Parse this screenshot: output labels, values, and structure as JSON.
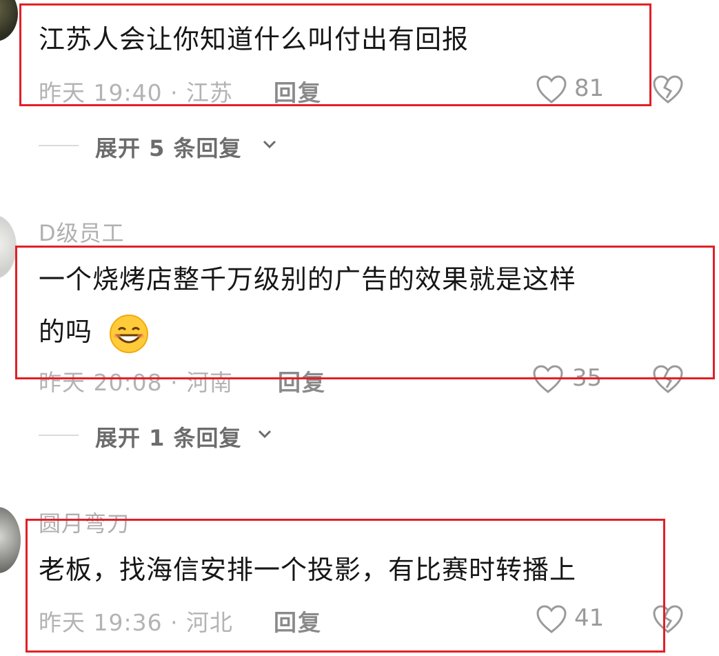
{
  "comments": [
    {
      "text": "江苏人会让你知道什么叫付出有回报",
      "meta": "昨天 19:40 · 江苏",
      "reply_label": "回复",
      "likes": "81",
      "expand_label": "展开 5 条回复"
    },
    {
      "username": "D级员工",
      "text_line1": "一个烧烤店整千万级别的广告的效果就是这样",
      "text_line2": "的吗",
      "meta": "昨天 20:08 · 河南",
      "reply_label": "回复",
      "likes": "35",
      "expand_label": "展开 1 条回复"
    },
    {
      "username": "圆月弯刀",
      "text": "老板，找海信安排一个投影，有比赛时转播上",
      "meta": "昨天 19:36 · 河北",
      "reply_label": "回复",
      "likes": "41"
    }
  ],
  "icons": {
    "like": "heart-outline-icon",
    "dislike": "broken-heart-icon",
    "expand": "chevron-down-icon",
    "emoji": "grinning-face-emoji"
  },
  "colors": {
    "highlight": "#e21f26",
    "meta": "#b3b3b3",
    "text": "#161616"
  }
}
